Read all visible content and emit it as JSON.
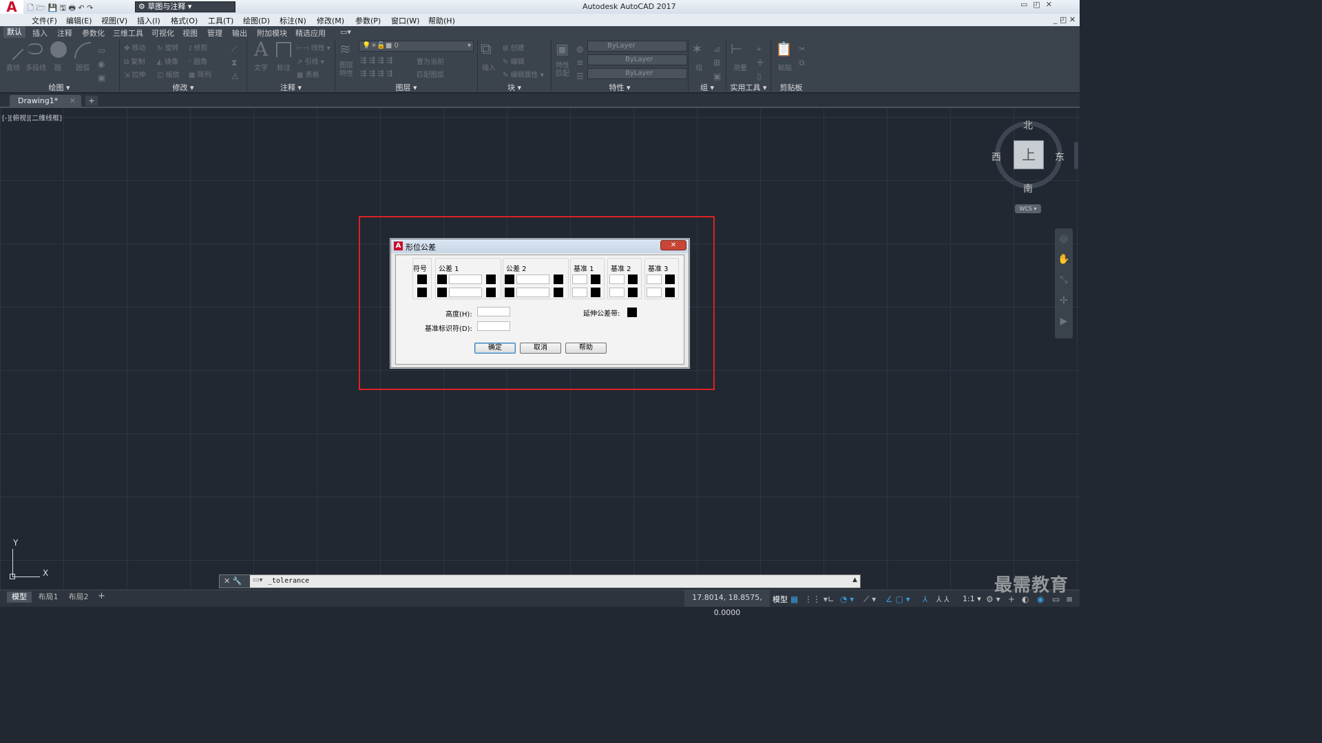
{
  "app": {
    "title": "Autodesk AutoCAD 2017",
    "logo": "A",
    "workspace": "草图与注释"
  },
  "menu": [
    "文件(F)",
    "编辑(E)",
    "视图(V)",
    "插入(I)",
    "格式(O)",
    "工具(T)",
    "绘图(D)",
    "标注(N)",
    "修改(M)",
    "参数(P)",
    "窗口(W)",
    "帮助(H)"
  ],
  "ribbon_tabs": [
    "默认",
    "插入",
    "注释",
    "参数化",
    "三维工具",
    "可视化",
    "视图",
    "管理",
    "输出",
    "附加模块",
    "精选应用"
  ],
  "ribbon_panels": [
    "绘图",
    "修改",
    "注释",
    "图层",
    "块",
    "特性",
    "组",
    "实用工具",
    "剪贴板"
  ],
  "tools": {
    "draw": [
      "直线",
      "多段线",
      "圆",
      "圆弧"
    ],
    "modify": [
      "移动",
      "旋转",
      "修剪",
      "复制",
      "镜像",
      "圆角",
      "拉伸",
      "缩放",
      "阵列"
    ],
    "annotate": [
      "文字",
      "标注",
      "线性",
      "引线",
      "表格"
    ],
    "layer": [
      "图层特性",
      "置为当前",
      "匹配图层"
    ],
    "layer_current": "0",
    "block": [
      "插入",
      "创建",
      "编辑",
      "编辑属性"
    ],
    "props": [
      "特性匹配"
    ],
    "prop_values": [
      "ByLayer",
      "ByLayer",
      "ByLayer"
    ],
    "group": [
      "组"
    ],
    "util": [
      "测量"
    ],
    "clip": [
      "粘贴"
    ]
  },
  "doc_tab": "Drawing1*",
  "viewport_label": "[-][俯视][二维线框]",
  "viewcube": {
    "north": "北",
    "south": "南",
    "east": "东",
    "west": "西",
    "top": "上",
    "wcs": "WCS"
  },
  "ucs": {
    "x": "X",
    "y": "Y"
  },
  "dialog": {
    "title": "形位公差",
    "headers": [
      "符号",
      "公差 1",
      "公差 2",
      "基准 1",
      "基准 2",
      "基准 3"
    ],
    "height_label": "高度(H):",
    "datum_id_label": "基准标识符(D):",
    "projected_label": "延伸公差带:",
    "ok": "确定",
    "cancel": "取消",
    "help": "帮助",
    "close": "✕"
  },
  "command": {
    "text": "_tolerance"
  },
  "layout_tabs": [
    "模型",
    "布局1",
    "布局2"
  ],
  "status": {
    "coords": "17.8014, 18.8575, 0.0000",
    "mode": "模型",
    "scale": "1:1"
  },
  "watermark": "最需教育",
  "colors": {
    "highlight": "#e02020",
    "canvas": "#212832"
  }
}
